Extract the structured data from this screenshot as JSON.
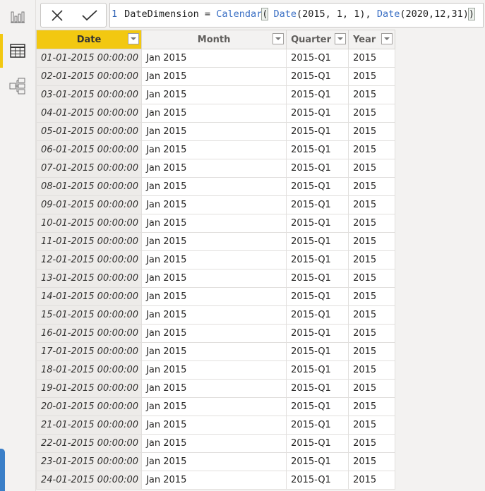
{
  "sidebar": {
    "items": [
      {
        "name": "report-view",
        "icon": "bar-chart-icon",
        "active": false
      },
      {
        "name": "data-view",
        "icon": "table-icon",
        "active": true
      },
      {
        "name": "model-view",
        "icon": "model-icon",
        "active": false
      }
    ]
  },
  "formula": {
    "cancel_icon": "close-icon",
    "commit_icon": "check-icon",
    "line_number": "1",
    "parts": {
      "lhs": "DateDimension = ",
      "fn1": "Calendar",
      "open1": "(",
      "space": " ",
      "fn2": "Date",
      "args2": "(2015, 1, 1), ",
      "fn3": "Date",
      "args3": "(2020,12,31)",
      "close1": ")"
    }
  },
  "table": {
    "columns": [
      "Date",
      "Month",
      "Quarter",
      "Year"
    ],
    "selected_column": "Date",
    "rows": [
      [
        "01-01-2015 00:00:00",
        "Jan 2015",
        "2015-Q1",
        "2015"
      ],
      [
        "02-01-2015 00:00:00",
        "Jan 2015",
        "2015-Q1",
        "2015"
      ],
      [
        "03-01-2015 00:00:00",
        "Jan 2015",
        "2015-Q1",
        "2015"
      ],
      [
        "04-01-2015 00:00:00",
        "Jan 2015",
        "2015-Q1",
        "2015"
      ],
      [
        "05-01-2015 00:00:00",
        "Jan 2015",
        "2015-Q1",
        "2015"
      ],
      [
        "06-01-2015 00:00:00",
        "Jan 2015",
        "2015-Q1",
        "2015"
      ],
      [
        "07-01-2015 00:00:00",
        "Jan 2015",
        "2015-Q1",
        "2015"
      ],
      [
        "08-01-2015 00:00:00",
        "Jan 2015",
        "2015-Q1",
        "2015"
      ],
      [
        "09-01-2015 00:00:00",
        "Jan 2015",
        "2015-Q1",
        "2015"
      ],
      [
        "10-01-2015 00:00:00",
        "Jan 2015",
        "2015-Q1",
        "2015"
      ],
      [
        "11-01-2015 00:00:00",
        "Jan 2015",
        "2015-Q1",
        "2015"
      ],
      [
        "12-01-2015 00:00:00",
        "Jan 2015",
        "2015-Q1",
        "2015"
      ],
      [
        "13-01-2015 00:00:00",
        "Jan 2015",
        "2015-Q1",
        "2015"
      ],
      [
        "14-01-2015 00:00:00",
        "Jan 2015",
        "2015-Q1",
        "2015"
      ],
      [
        "15-01-2015 00:00:00",
        "Jan 2015",
        "2015-Q1",
        "2015"
      ],
      [
        "16-01-2015 00:00:00",
        "Jan 2015",
        "2015-Q1",
        "2015"
      ],
      [
        "17-01-2015 00:00:00",
        "Jan 2015",
        "2015-Q1",
        "2015"
      ],
      [
        "18-01-2015 00:00:00",
        "Jan 2015",
        "2015-Q1",
        "2015"
      ],
      [
        "19-01-2015 00:00:00",
        "Jan 2015",
        "2015-Q1",
        "2015"
      ],
      [
        "20-01-2015 00:00:00",
        "Jan 2015",
        "2015-Q1",
        "2015"
      ],
      [
        "21-01-2015 00:00:00",
        "Jan 2015",
        "2015-Q1",
        "2015"
      ],
      [
        "22-01-2015 00:00:00",
        "Jan 2015",
        "2015-Q1",
        "2015"
      ],
      [
        "23-01-2015 00:00:00",
        "Jan 2015",
        "2015-Q1",
        "2015"
      ],
      [
        "24-01-2015 00:00:00",
        "Jan 2015",
        "2015-Q1",
        "2015"
      ]
    ]
  },
  "colors": {
    "accent": "#f2c811",
    "keyword": "#3a6fc4",
    "bottom_tab": "#3a7fc8"
  }
}
